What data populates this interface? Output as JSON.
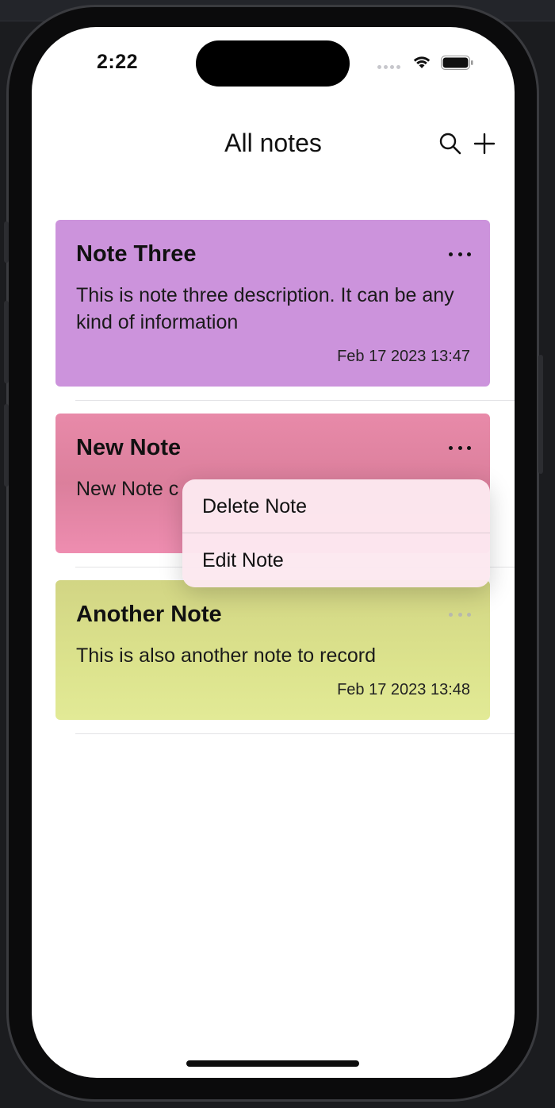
{
  "status_bar": {
    "time": "2:22"
  },
  "nav": {
    "title": "All notes",
    "search_icon": "search-icon",
    "add_icon": "plus-icon"
  },
  "notes": [
    {
      "title": "Note Three",
      "description": "This is note three description. It can be any kind of information",
      "date": "Feb 17 2023 13:47",
      "color": "#cc93dc"
    },
    {
      "title": "New Note",
      "description": "New Note c",
      "date": "",
      "color": "#e882a4"
    },
    {
      "title": "Another Note",
      "description": "This is also another note to record",
      "date": "Feb 17 2023 13:48",
      "color": "#d9e08a"
    }
  ],
  "context_menu": {
    "items": [
      {
        "label": "Delete Note"
      },
      {
        "label": "Edit Note"
      }
    ]
  },
  "colors": {
    "note_three": "#cc93dc",
    "new_note": "#e882a4",
    "another_note": "#d9e08a",
    "menu_background": "#fce8f0"
  }
}
